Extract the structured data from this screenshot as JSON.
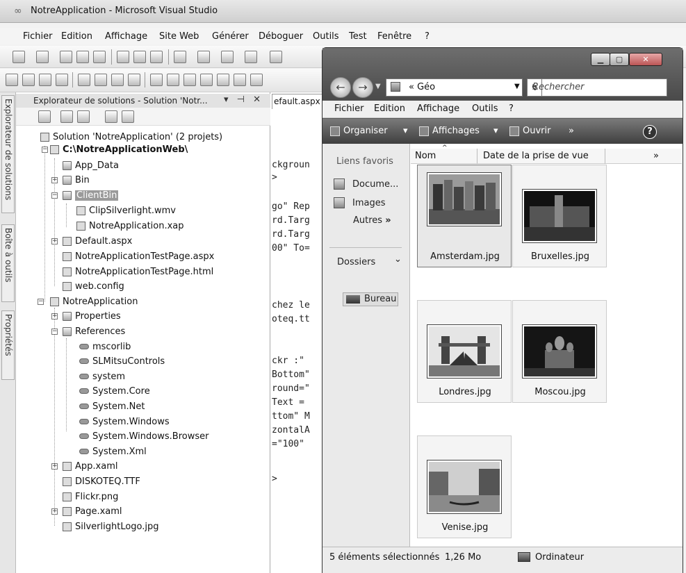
{
  "vs": {
    "title": "NotreApplication - Microsoft Visual Studio",
    "menu": [
      "Fichier",
      "Edition",
      "Affichage",
      "Site Web",
      "Générer",
      "Déboguer",
      "Outils",
      "Test",
      "Fenêtre",
      "?"
    ]
  },
  "dock": {
    "tabs": [
      "Explorateur de solutions",
      "Boîte à outils",
      "Propriétés"
    ]
  },
  "solution_explorer": {
    "title": "Explorateur de solutions - Solution 'Notr...",
    "header_controls": "▾ ⊣ ✕",
    "tree": [
      {
        "label": "Solution 'NotreApplication' (2 projets)"
      },
      {
        "label": "C:\\NotreApplicationWeb\\"
      },
      {
        "label": "App_Data"
      },
      {
        "label": "Bin"
      },
      {
        "label": "ClientBin"
      },
      {
        "label": "ClipSilverlight.wmv"
      },
      {
        "label": "NotreApplication.xap"
      },
      {
        "label": "Default.aspx"
      },
      {
        "label": "NotreApplicationTestPage.aspx"
      },
      {
        "label": "NotreApplicationTestPage.html"
      },
      {
        "label": "web.config"
      },
      {
        "label": "NotreApplication"
      },
      {
        "label": "Properties"
      },
      {
        "label": "References"
      },
      {
        "label": "mscorlib"
      },
      {
        "label": "SLMitsuControls"
      },
      {
        "label": "system"
      },
      {
        "label": "System.Core"
      },
      {
        "label": "System.Net"
      },
      {
        "label": "System.Windows"
      },
      {
        "label": "System.Windows.Browser"
      },
      {
        "label": "System.Xml"
      },
      {
        "label": "App.xaml"
      },
      {
        "label": "DISKOTEQ.TTF"
      },
      {
        "label": "Flickr.png"
      },
      {
        "label": "Page.xaml"
      },
      {
        "label": "SilverlightLogo.jpg"
      }
    ]
  },
  "editor": {
    "tab": "efault.aspx",
    "lines": [
      "ckgroun",
      ">",
      "go\" Rep",
      "rd.Targ",
      "rd.Targ",
      "00\" To=",
      "chez le",
      "oteq.tt",
      "ckr :\"",
      "Bottom\"",
      "round=\"",
      "Text =",
      "ttom\" M",
      "zontalA",
      "=\"100\"",
      ">"
    ]
  },
  "explorer": {
    "address": "« Géo",
    "search_placeholder": "Rechercher",
    "menu": [
      "Fichier",
      "Edition",
      "Affichage",
      "Outils",
      "?"
    ],
    "commands": {
      "organiser": "Organiser",
      "affichages": "Affichages",
      "ouvrir": "Ouvrir",
      "more": "»"
    },
    "nav": {
      "favorites_title": "Liens favoris",
      "links": [
        "Docume...",
        "Images"
      ],
      "autres": "Autres",
      "autres_more": "»",
      "dossiers": "Dossiers",
      "dossiers_chevron": "⌄",
      "bureau": "Bureau"
    },
    "columns": {
      "nom": "Nom",
      "date": "Date de la prise de vue",
      "more": "»"
    },
    "files": [
      "Amsterdam.jpg",
      "Bruxelles.jpg",
      "Londres.jpg",
      "Moscou.jpg",
      "Venise.jpg"
    ],
    "status": {
      "selection": "5 éléments sélectionnés",
      "size": "1,26 Mo",
      "location": "Ordinateur"
    }
  }
}
